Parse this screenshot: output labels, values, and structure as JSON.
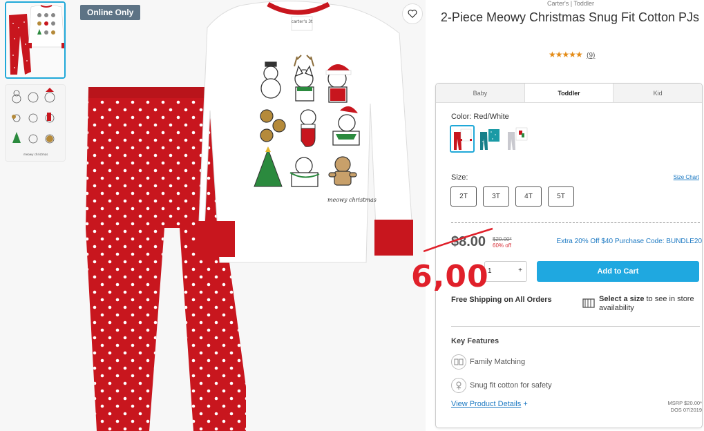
{
  "badge": "Online Only",
  "product": {
    "brand_line": "Carter's | Toddler",
    "title": "2-Piece Meowy Christmas Snug Fit Cotton PJs",
    "stars": "★★★★★",
    "rating_count": "(9)",
    "shirt_tag": "carter's 3t",
    "shirt_caption": "meowy christmas"
  },
  "tabs": [
    "Baby",
    "Toddler",
    "Kid"
  ],
  "active_tab": "Toddler",
  "color": {
    "label": "Color:",
    "value": "Red/White"
  },
  "size": {
    "label": "Size:",
    "chart_link": "Size Chart",
    "options": [
      "2T",
      "3T",
      "4T",
      "5T"
    ]
  },
  "price": {
    "current": "$8.00",
    "was": "$20.00*",
    "off": "60% off",
    "promo": "Extra 20% Off $40 Purchase Code: BUNDLE20",
    "handwritten": "6,00"
  },
  "quantity": {
    "value": "1",
    "plus": "+"
  },
  "add_to_cart": "Add to Cart",
  "shipping": "Free Shipping on All Orders",
  "store": {
    "bold": "Select a size",
    "rest": " to see in store availability"
  },
  "features": {
    "heading": "Key Features",
    "items": [
      "Family Matching",
      "Snug fit cotton for safety"
    ]
  },
  "details_link": "View Product Details",
  "details_plus": "+",
  "msrp": {
    "line1": "MSRP $20.00*",
    "line2": "DOS 07/2019"
  },
  "colors": {
    "accent": "#1fa8e0",
    "pj_red": "#c8161e",
    "badge": "#5d7385",
    "star": "#e48b16"
  }
}
